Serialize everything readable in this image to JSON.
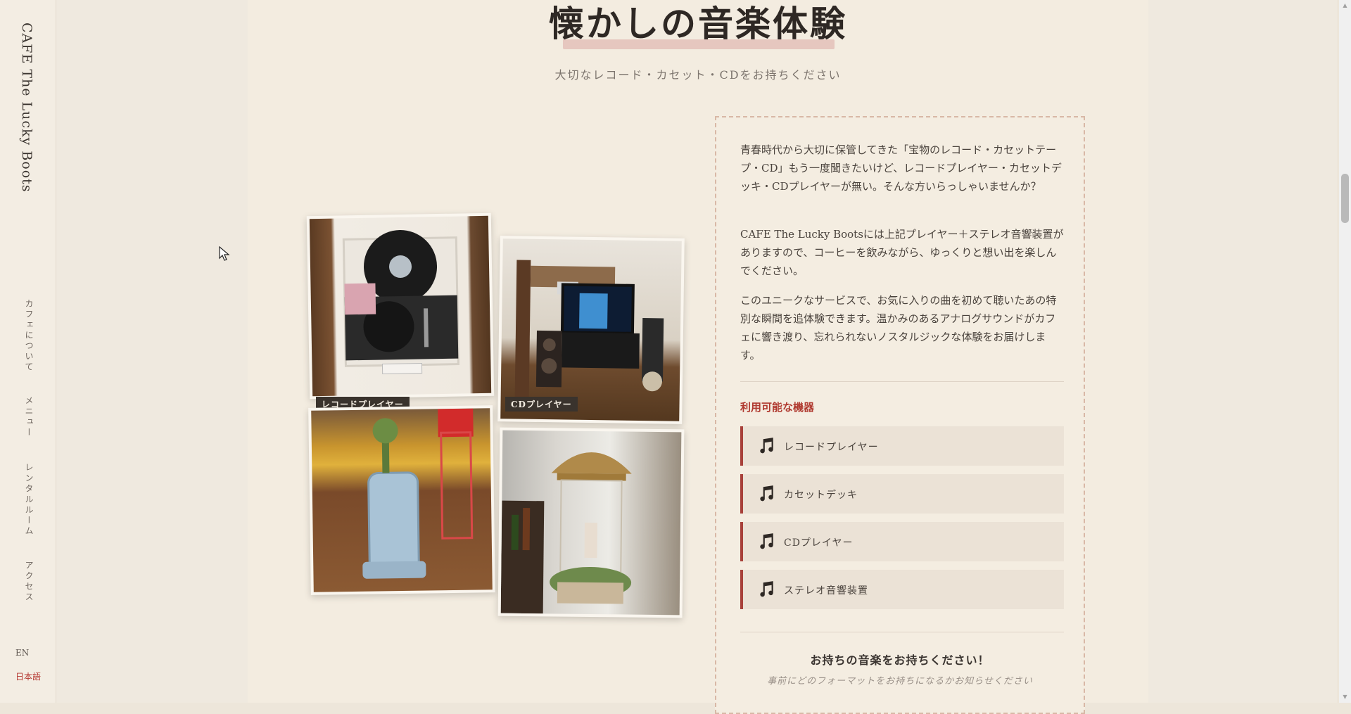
{
  "sidebar": {
    "brand": "CAFE The Lucky Boots",
    "nav": [
      {
        "label": "カフェについて"
      },
      {
        "label": "メニュー"
      },
      {
        "label": "レンタルルーム"
      },
      {
        "label": "アクセス"
      }
    ],
    "lang_en": "EN",
    "lang_ja": "日本語"
  },
  "section": {
    "title": "懐かしの音楽体験",
    "subtitle": "大切なレコード・カセット・CDをお持ちください"
  },
  "photos": [
    {
      "caption": "レコードプレイヤー",
      "icon": "record-player-photo"
    },
    {
      "caption": "CDプレイヤー",
      "icon": "cd-player-photo"
    },
    {
      "caption": "",
      "icon": "kerosene-heater-photo"
    },
    {
      "caption": "",
      "icon": "rain-lamp-photo"
    }
  ],
  "card": {
    "p1": "青春時代から大切に保管してきた「宝物のレコード・カセットテープ・CD」もう一度聞きたいけど、レコードプレイヤー・カセットデッキ・CDプレイヤーが無い。そんな方いらっしゃいませんか？",
    "p2": "CAFE The Lucky Bootsには上記プレイヤー＋ステレオ音響装置がありますので、コーヒーを飲みながら、ゆっくりと想い出を楽しんでください。",
    "p3": "このユニークなサービスで、お気に入りの曲を初めて聴いたあの特別な瞬間を追体験できます。温かみのあるアナログサウンドがカフェに響き渡り、忘れられないノスタルジックな体験をお届けします。",
    "equip_heading": "利用可能な機器",
    "equipment": [
      {
        "label": "レコードプレイヤー",
        "icon": "music-note-icon"
      },
      {
        "label": "カセットデッキ",
        "icon": "music-note-icon"
      },
      {
        "label": "CDプレイヤー",
        "icon": "music-note-icon"
      },
      {
        "label": "ステレオ音響装置",
        "icon": "music-note-icon"
      }
    ],
    "bring_title": "お持ちの音楽をお持ちください！",
    "bring_note": "事前にどのフォーマットをお持ちになるかお知らせください"
  },
  "colors": {
    "accent": "#b5362f",
    "background": "#f3ece0",
    "underline": "#e6c7bf"
  }
}
